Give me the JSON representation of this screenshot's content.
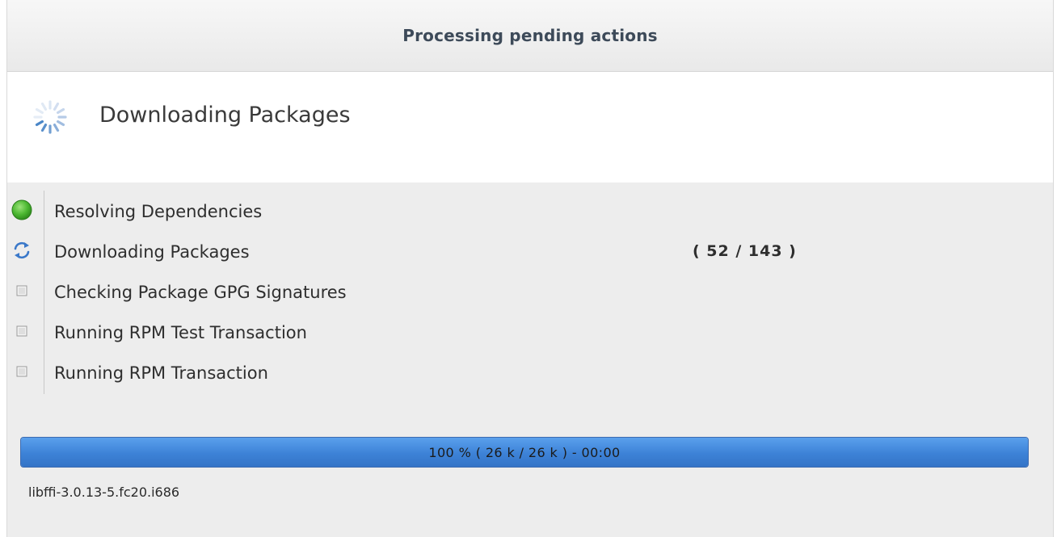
{
  "window": {
    "title": "Processing pending actions"
  },
  "header": {
    "spinner_icon": "spinner-icon",
    "label": "Downloading Packages"
  },
  "steps": [
    {
      "label": "Resolving Dependencies",
      "status": "done",
      "icon": "green-dot-icon",
      "count": ""
    },
    {
      "label": "Downloading Packages",
      "status": "in-progress",
      "icon": "refresh-icon",
      "count": "( 52 / 143 )"
    },
    {
      "label": "Checking Package GPG Signatures",
      "status": "pending",
      "icon": "checkbox-icon",
      "count": ""
    },
    {
      "label": "Running RPM Test Transaction",
      "status": "pending",
      "icon": "checkbox-icon",
      "count": ""
    },
    {
      "label": "Running RPM Transaction",
      "status": "pending",
      "icon": "checkbox-icon",
      "count": ""
    }
  ],
  "progress": {
    "fraction": 1.0,
    "text": "100 % ( 26 k / 26 k ) - 00:00"
  },
  "package": {
    "name": "libffi-3.0.13-5.fc20.i686"
  },
  "colors": {
    "done": "#3fae2a",
    "in_progress": "#3a78c9",
    "progress_fill": "#3d82d7",
    "title_text": "#3d4a59"
  }
}
